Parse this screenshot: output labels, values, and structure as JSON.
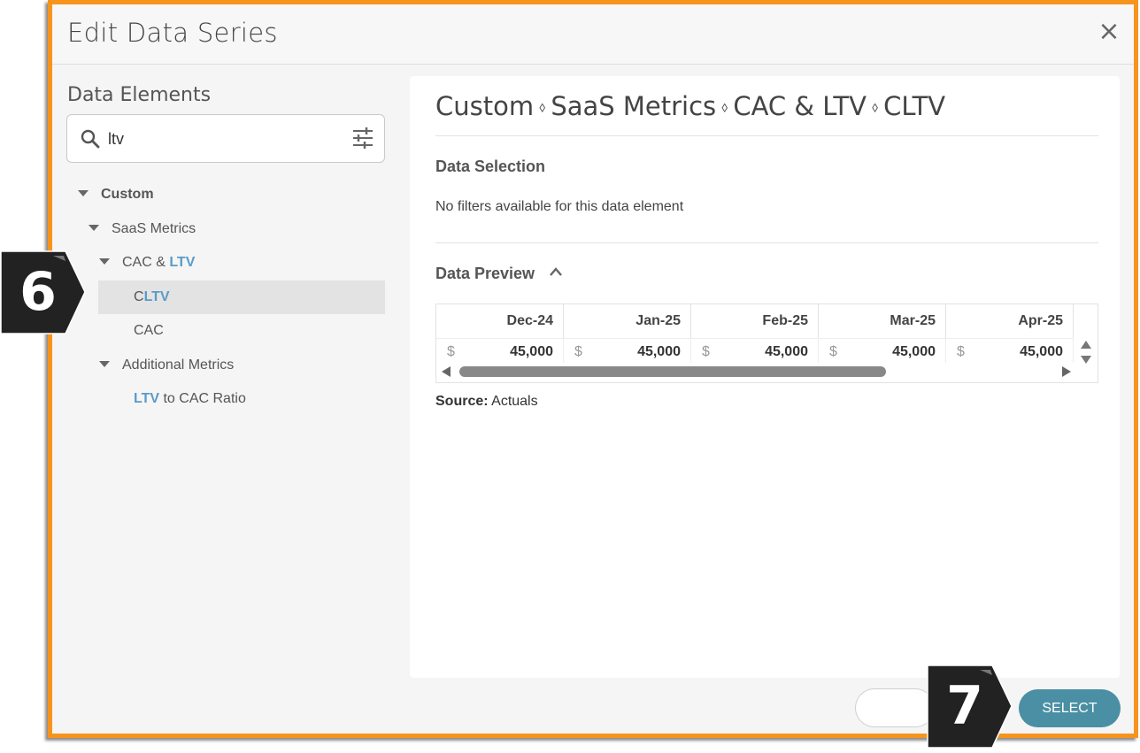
{
  "dialog": {
    "title": "Edit Data Series",
    "close_symbol": "×"
  },
  "left": {
    "title": "Data Elements",
    "search": {
      "value": "ltv",
      "placeholder": ""
    },
    "tree": {
      "custom": "Custom",
      "saas": "SaaS Metrics",
      "cac_ltv_prefix": "CAC & ",
      "cac_ltv_hl": "LTV",
      "cltv_prefix": "C",
      "cltv_hl": "LTV",
      "cac": "CAC",
      "additional": "Additional Metrics",
      "ratio_hl": "LTV",
      "ratio_suffix": " to CAC Ratio"
    }
  },
  "right": {
    "breadcrumb": [
      "Custom",
      "SaaS Metrics",
      "CAC & LTV",
      "CLTV"
    ],
    "breadcrumb_sep": "⬨",
    "data_selection_title": "Data Selection",
    "data_selection_note": "No filters available for this data element",
    "data_preview_title": "Data Preview",
    "table": {
      "headers": [
        "Dec-24",
        "Jan-25",
        "Feb-25",
        "Mar-25",
        "Apr-25"
      ],
      "currency": "$",
      "values": [
        "45,000",
        "45,000",
        "45,000",
        "45,000",
        "45,000"
      ]
    },
    "source_label": "Source:",
    "source_value": " Actuals"
  },
  "footer": {
    "select_label": "SELECT"
  },
  "badges": {
    "step6": "6",
    "step7": "7"
  },
  "colors": {
    "frame_border": "#f7941d",
    "highlight": "#5b9bc8",
    "select_button": "#4a8fa3",
    "badge_fill": "#222222"
  }
}
